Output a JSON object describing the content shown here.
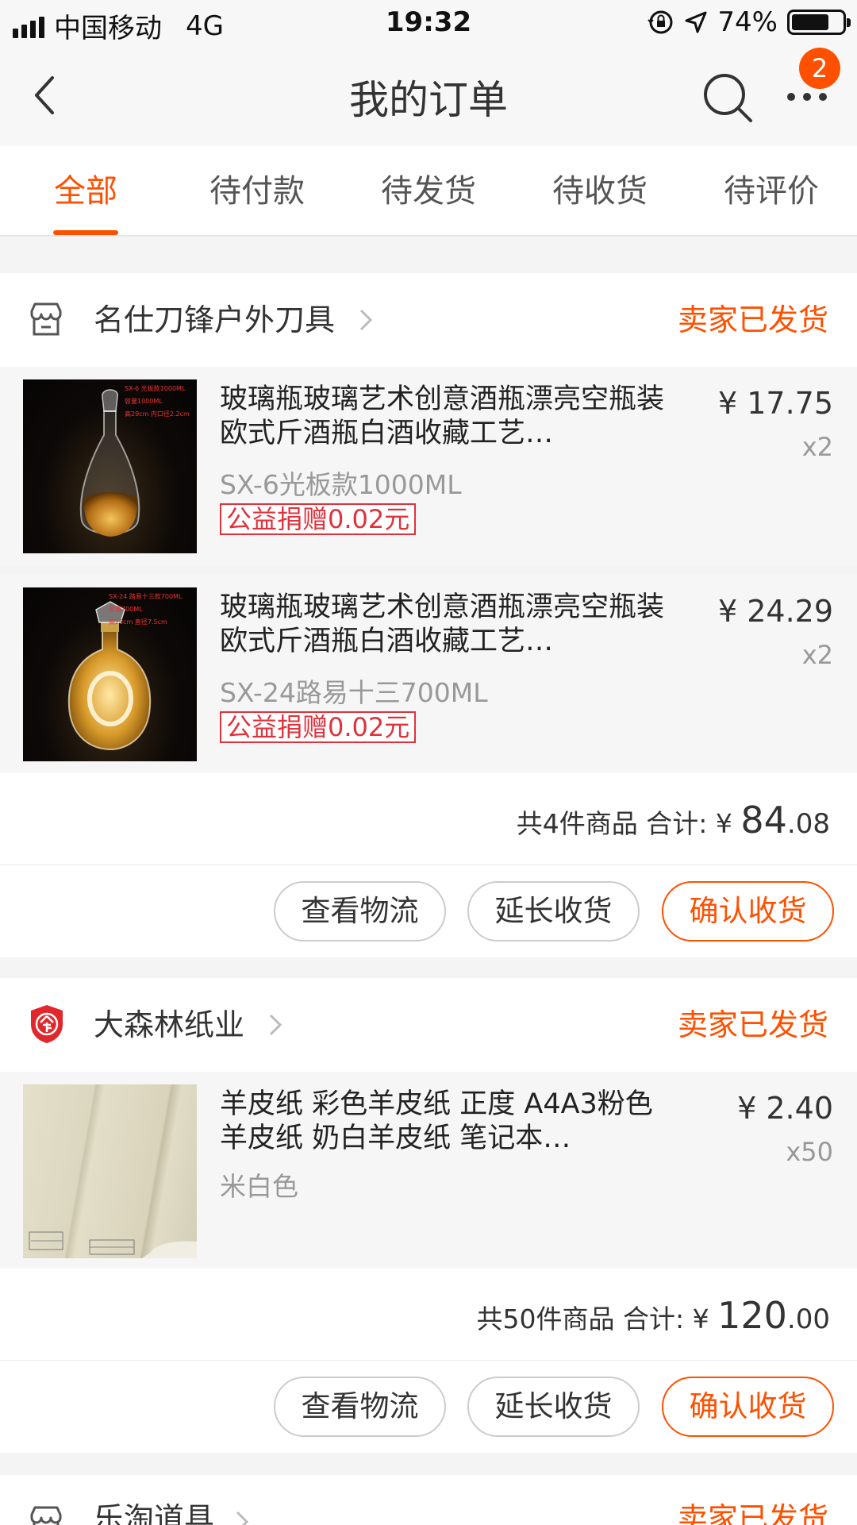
{
  "status_bar": {
    "carrier": "中国移动",
    "network": "4G",
    "time": "19:32",
    "battery": "74%",
    "battery_level": 0.74
  },
  "nav": {
    "title": "我的订单",
    "back_icon": "chevron-left-icon",
    "search_icon": "search-icon",
    "more_icon": "more-icon",
    "badge": "2"
  },
  "tabs": [
    {
      "label": "全部",
      "active": true
    },
    {
      "label": "待付款"
    },
    {
      "label": "待发货"
    },
    {
      "label": "待收货"
    },
    {
      "label": "待评价"
    }
  ],
  "orders": [
    {
      "store_name": "名仕刀锋户外刀具",
      "store_icon": "shop-icon",
      "status": "卖家已发货",
      "items": [
        {
          "title": "玻璃瓶玻璃艺术创意酒瓶漂亮空瓶装欧式斤酒瓶白酒收藏工艺…",
          "sku": "SX-6光板款1000ML",
          "promo": "公益捐赠0.02元",
          "price": "¥ 17.75",
          "qty": "x2",
          "thumb_text": [
            "SX-6 光板款1000ML",
            "容量1000ML",
            "高29cm 内口径2.2cm"
          ]
        },
        {
          "title": "玻璃瓶玻璃艺术创意酒瓶漂亮空瓶装欧式斤酒瓶白酒收藏工艺…",
          "sku": "SX-24路易十三700ML",
          "promo": "公益捐赠0.02元",
          "price": "¥ 24.29",
          "qty": "x2",
          "thumb_text": [
            "SX-24 路易十三款700ML",
            "容量700ML",
            "高23cm 直径7.5cm"
          ]
        }
      ],
      "summary_prefix": "共4件商品 合计: ¥ ",
      "total_int": "84",
      "total_dec": ".08",
      "buttons": [
        "查看物流",
        "延长收货",
        "确认收货"
      ]
    },
    {
      "store_name": "大森林纸业",
      "store_icon": "enterprise-shield-icon",
      "status": "卖家已发货",
      "items": [
        {
          "title": "羊皮纸 彩色羊皮纸 正度 A4A3粉色羊皮纸 奶白羊皮纸 笔记本…",
          "sku": "米白色",
          "price": "¥ 2.40",
          "qty": "x50"
        }
      ],
      "summary_prefix": "共50件商品 合计: ¥ ",
      "total_int": "120",
      "total_dec": ".00",
      "buttons": [
        "查看物流",
        "延长收货",
        "确认收货"
      ]
    },
    {
      "store_name": "乐淘道具",
      "store_icon": "shop-icon",
      "status": "卖家已发货"
    }
  ],
  "colors": {
    "accent": "#ff5000",
    "promo": "#e0323c",
    "enterprise_badge": "#e0272b"
  }
}
